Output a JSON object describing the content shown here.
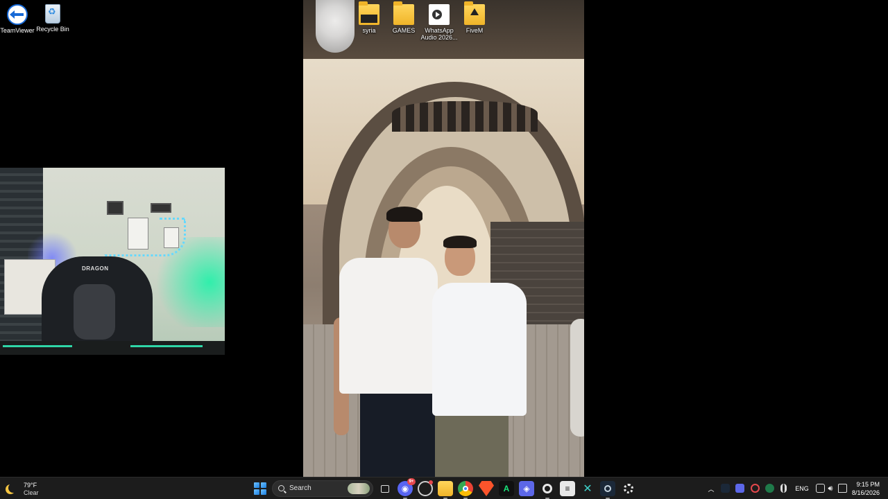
{
  "desktop": {
    "icons": [
      {
        "label": "TeamViewer",
        "icon": "teamviewer-icon"
      },
      {
        "label": "Recycle Bin",
        "icon": "recycle-bin-icon"
      },
      {
        "label": "syria",
        "icon": "folder-icon"
      },
      {
        "label": "GAMES",
        "icon": "folder-icon"
      },
      {
        "label": "WhatsApp Audio 2026...",
        "icon": "audio-file-icon"
      },
      {
        "label": "FiveM",
        "icon": "folder-icon"
      }
    ]
  },
  "webcam": {
    "chair_logo": "DRAGON",
    "accent_color": "#2fd6a7"
  },
  "taskbar": {
    "weather": {
      "temp": "79°F",
      "condition": "Clear"
    },
    "search": {
      "placeholder": "Search"
    },
    "apps": [
      {
        "name": "Task View",
        "icon": "task-view-icon"
      },
      {
        "name": "Discord",
        "icon": "discord-icon",
        "badge": "9+"
      },
      {
        "name": "App",
        "icon": "app-icon"
      },
      {
        "name": "File Explorer",
        "icon": "folder-icon"
      },
      {
        "name": "Chrome",
        "icon": "chrome-icon"
      },
      {
        "name": "Brave",
        "icon": "brave-icon"
      },
      {
        "name": "Green App",
        "icon": "a-icon"
      },
      {
        "name": "App",
        "icon": "cube-icon"
      },
      {
        "name": "SteelSeries",
        "icon": "steelseries-icon"
      },
      {
        "name": "App",
        "icon": "app-icon"
      },
      {
        "name": "App",
        "icon": "x-icon"
      },
      {
        "name": "Steam",
        "icon": "steam-icon"
      },
      {
        "name": "SteelSeries",
        "icon": "steelseries-icon"
      }
    ],
    "tray": {
      "language": "ENG",
      "time": "9:15 PM",
      "date": "8/16/2026"
    }
  }
}
